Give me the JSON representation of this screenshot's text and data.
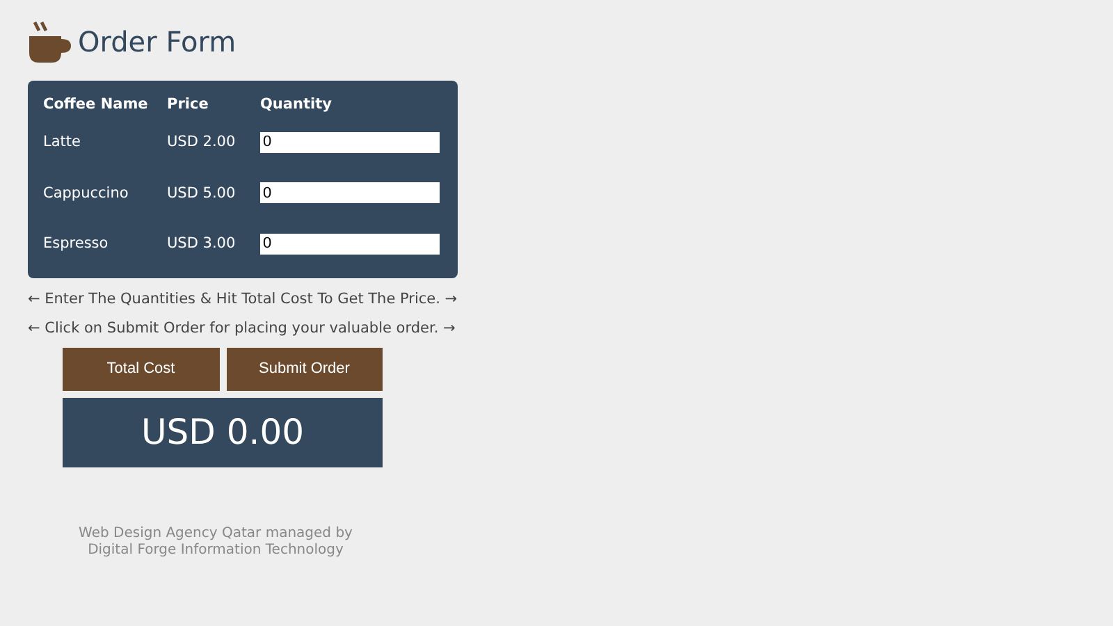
{
  "title": "Order Form",
  "table": {
    "columns": [
      "Coffee Name",
      "Price",
      "Quantity"
    ],
    "rows": [
      {
        "name": "Latte",
        "price": "USD 2.00",
        "quantity": "0"
      },
      {
        "name": "Cappuccino",
        "price": "USD 5.00",
        "quantity": "0"
      },
      {
        "name": "Espresso",
        "price": "USD 3.00",
        "quantity": "0"
      }
    ]
  },
  "instructions": [
    "← Enter The Quantities & Hit Total Cost To Get The Price. →",
    "← Click on Submit Order for placing your valuable order. →"
  ],
  "buttons": [
    "Total Cost",
    "Submit Order"
  ],
  "total": "USD 0.00",
  "footer": [
    "Web Design Agency Qatar managed by",
    "Digital Forge Information Technology"
  ]
}
